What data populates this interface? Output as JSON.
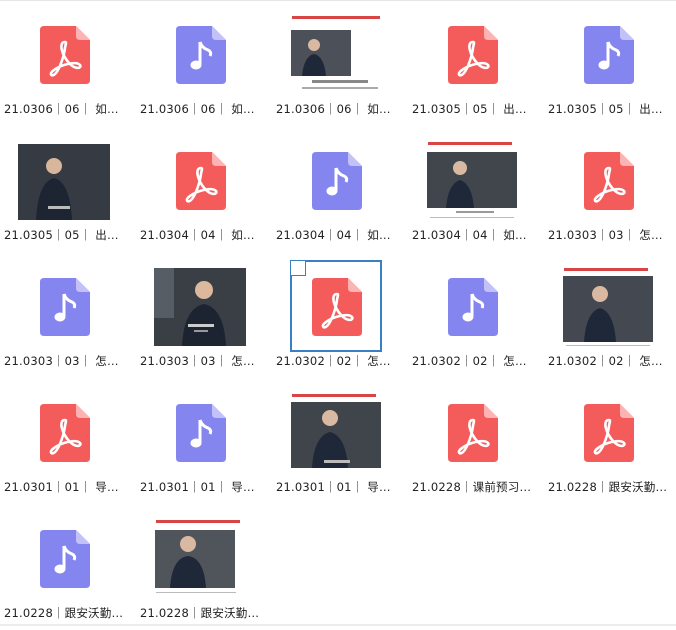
{
  "items": [
    {
      "label": "21.0306｜06｜ 如…",
      "type": "pdf"
    },
    {
      "label": "21.0306｜06｜ 如…",
      "type": "audio"
    },
    {
      "label": "21.0306｜06｜ 如…",
      "type": "video-slide"
    },
    {
      "label": "21.0305｜05｜ 出…",
      "type": "pdf"
    },
    {
      "label": "21.0305｜05｜ 出…",
      "type": "audio"
    },
    {
      "label": "21.0305｜05｜ 出…",
      "type": "video"
    },
    {
      "label": "21.0304｜04｜ 如…",
      "type": "pdf"
    },
    {
      "label": "21.0304｜04｜ 如…",
      "type": "audio"
    },
    {
      "label": "21.0304｜04｜ 如…",
      "type": "video-slide"
    },
    {
      "label": "21.0303｜03｜ 怎…",
      "type": "pdf"
    },
    {
      "label": "21.0303｜03｜ 怎…",
      "type": "audio"
    },
    {
      "label": "21.0303｜03｜ 怎…",
      "type": "video"
    },
    {
      "label": "21.0302｜02｜ 怎…",
      "type": "pdf",
      "selected": true
    },
    {
      "label": "21.0302｜02｜ 怎…",
      "type": "audio"
    },
    {
      "label": "21.0302｜02｜ 怎…",
      "type": "video-slide"
    },
    {
      "label": "21.0301｜01｜ 导…",
      "type": "pdf"
    },
    {
      "label": "21.0301｜01｜ 导…",
      "type": "audio"
    },
    {
      "label": "21.0301｜01｜ 导…",
      "type": "video-slide"
    },
    {
      "label": "21.0228｜课前预习…",
      "type": "pdf"
    },
    {
      "label": "21.0228｜跟安沃勤…",
      "type": "pdf"
    },
    {
      "label": "21.0228｜跟安沃勤…",
      "type": "audio"
    },
    {
      "label": "21.0228｜跟安沃勤…",
      "type": "video-slide"
    }
  ],
  "colors": {
    "pdf": "#f45c5c",
    "audio": "#8585f0",
    "selection": "#3a7ec4"
  },
  "icons": {
    "pdf": "pdf-icon",
    "audio": "music-note-icon"
  }
}
